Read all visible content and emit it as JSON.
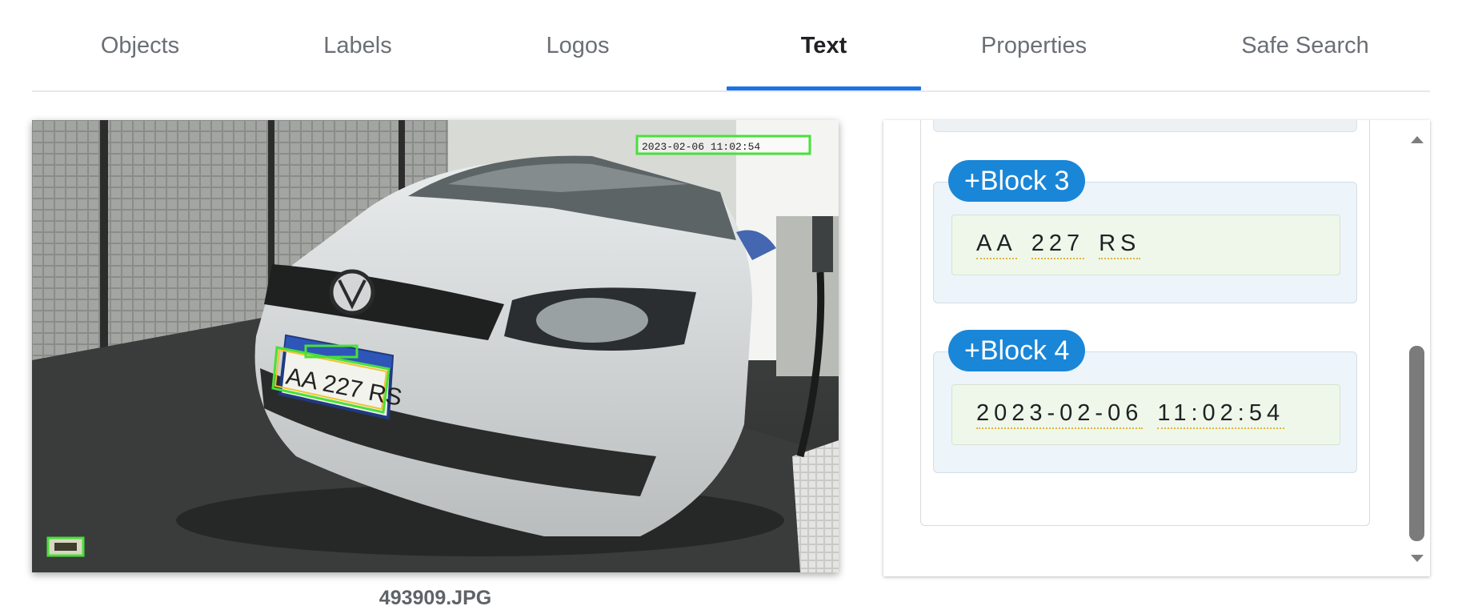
{
  "tabs": [
    {
      "label": "Objects"
    },
    {
      "label": "Labels"
    },
    {
      "label": "Logos"
    },
    {
      "label": "Text"
    },
    {
      "label": "Properties"
    },
    {
      "label": "Safe Search"
    }
  ],
  "active_tab": "Text",
  "image": {
    "filename": "493909.JPG",
    "detected_texts": [
      "AA 227 RS",
      "2023-02-06 11:02:54"
    ]
  },
  "blocks": [
    {
      "chip": "+Block 3",
      "words": [
        "AA",
        "227",
        "RS"
      ]
    },
    {
      "chip": "+Block 4",
      "words": [
        "2023-02-06",
        "11:02:54"
      ]
    }
  ],
  "colors": {
    "accent": "#1a73e8",
    "chip": "#1a86d8",
    "box_outline": "#49e03a",
    "box_inner": "#f2c230"
  }
}
